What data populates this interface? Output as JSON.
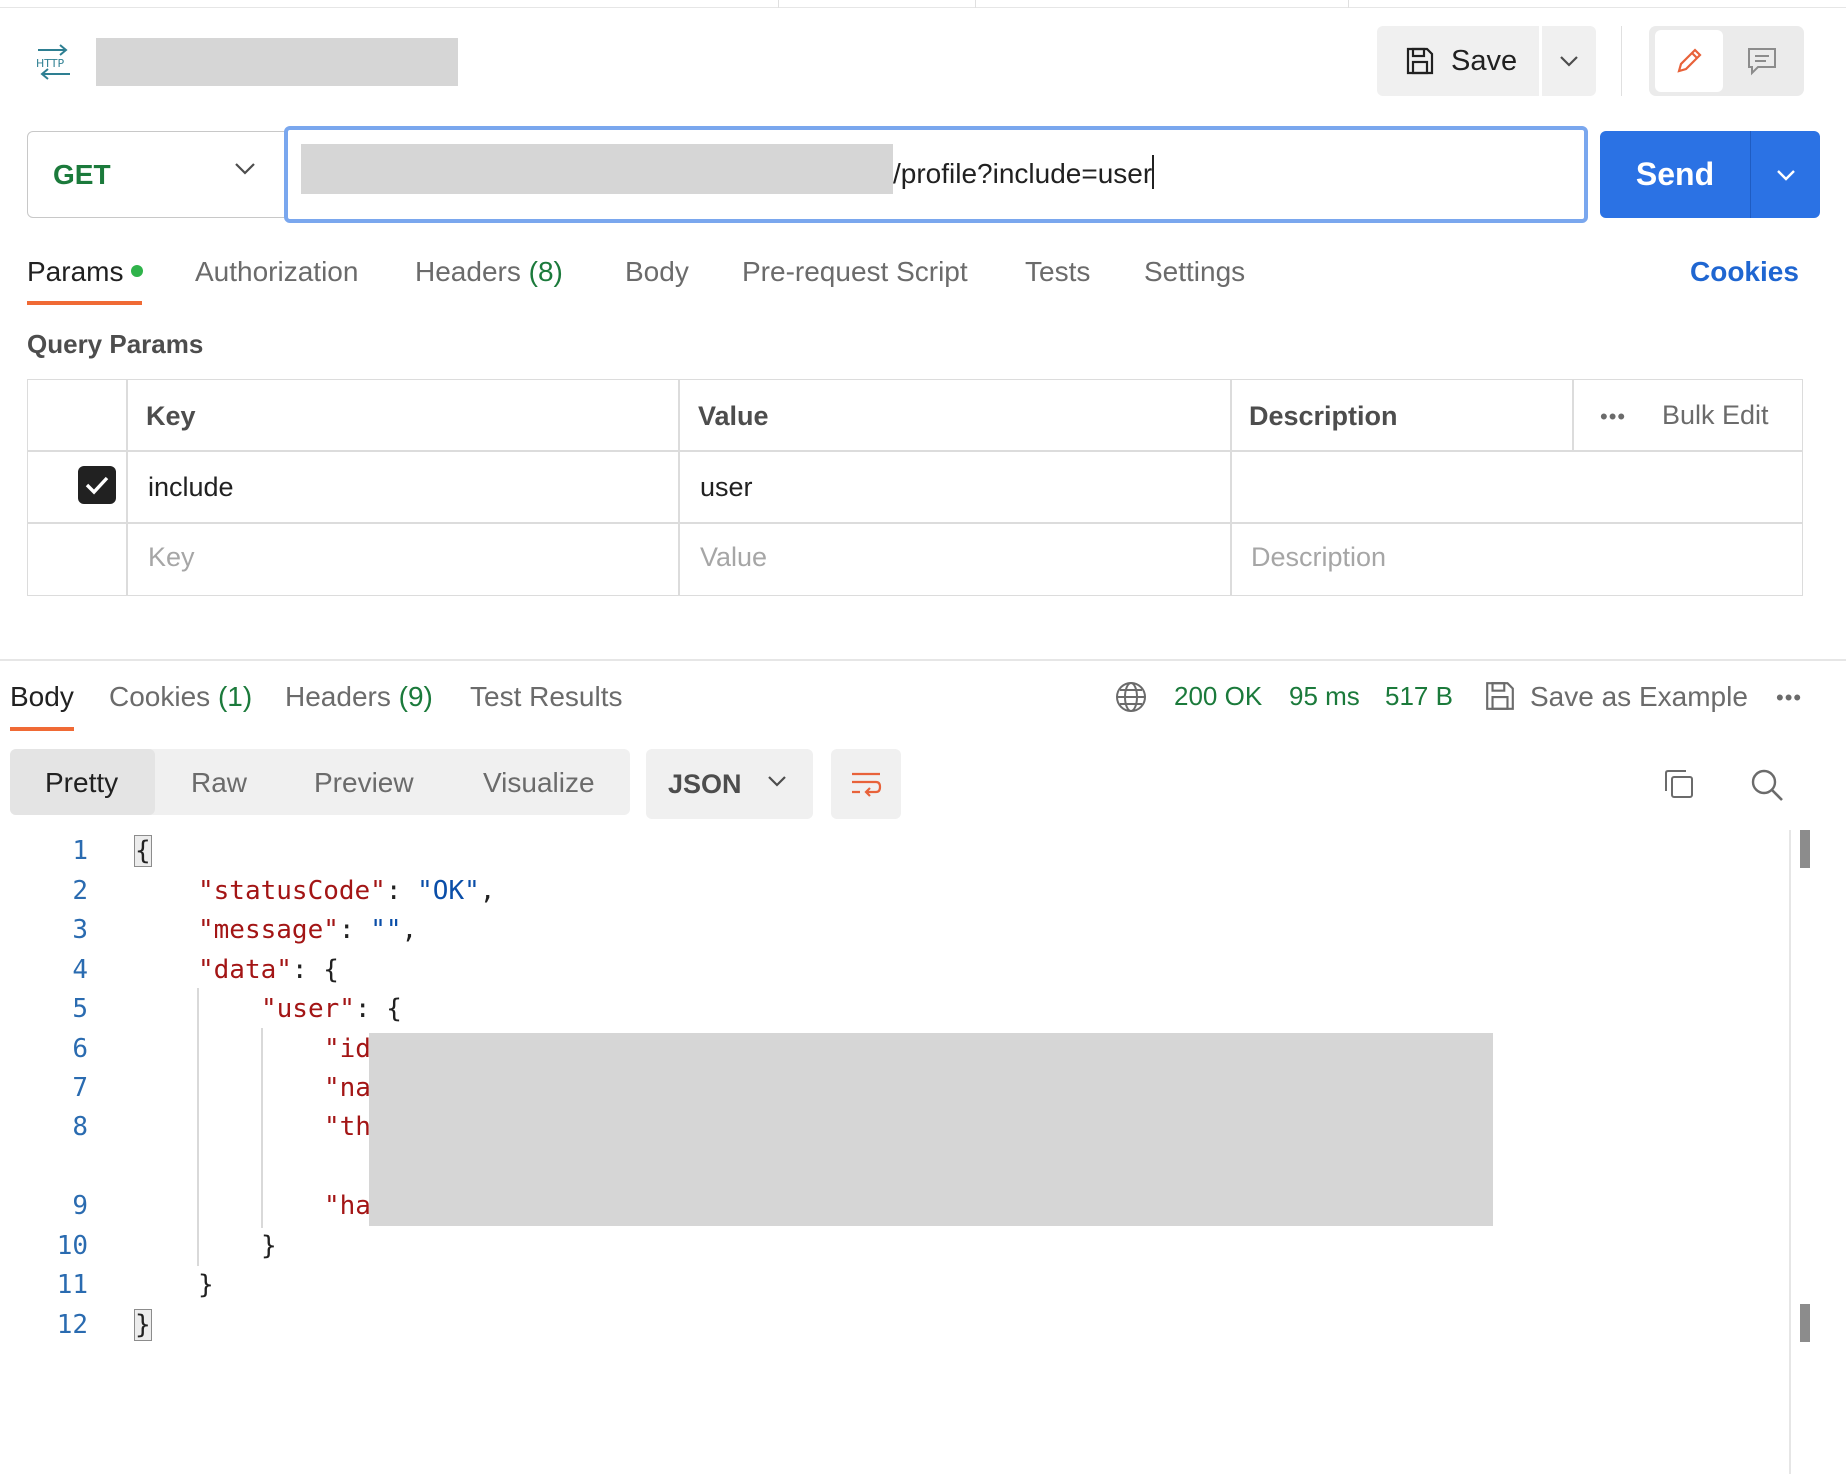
{
  "header": {
    "protocol_badge": "HTTP",
    "save_label": "Save"
  },
  "request": {
    "method": "GET",
    "url_visible": "/profile?include=user",
    "send_label": "Send"
  },
  "request_tabs": {
    "params": "Params",
    "authorization": "Authorization",
    "headers": "Headers",
    "headers_count": "(8)",
    "body": "Body",
    "prerequest": "Pre-request Script",
    "tests": "Tests",
    "settings": "Settings",
    "cookies": "Cookies"
  },
  "query_params": {
    "title": "Query Params",
    "columns": {
      "key": "Key",
      "value": "Value",
      "description": "Description"
    },
    "more": "•••",
    "bulk_edit": "Bulk Edit",
    "rows": [
      {
        "checked": true,
        "key": "include",
        "value": "user",
        "description": ""
      }
    ],
    "placeholder": {
      "key": "Key",
      "value": "Value",
      "description": "Description"
    }
  },
  "response_tabs": {
    "body": "Body",
    "cookies": "Cookies",
    "cookies_count": "(1)",
    "headers": "Headers",
    "headers_count": "(9)",
    "test_results": "Test Results"
  },
  "response_status": {
    "status": "200 OK",
    "time": "95 ms",
    "size": "517 B",
    "save_example": "Save as Example",
    "more": "•••",
    "status_color": "#1b7a3b"
  },
  "body_toolbar": {
    "views": [
      "Pretty",
      "Raw",
      "Preview",
      "Visualize"
    ],
    "active_view": "Pretty",
    "format": "JSON"
  },
  "code": {
    "line_numbers": [
      "1",
      "2",
      "3",
      "4",
      "5",
      "6",
      "7",
      "8",
      "9",
      "10",
      "11",
      "12"
    ],
    "l1": "{",
    "l2_key": "\"statusCode\"",
    "l2_sep": ": ",
    "l2_val": "\"OK\"",
    "l2_end": ",",
    "l3_key": "\"message\"",
    "l3_sep": ": ",
    "l3_val": "\"\"",
    "l3_end": ",",
    "l4_key": "\"data\"",
    "l4_rest": ": {",
    "l5_key": "\"user\"",
    "l5_rest": ": {",
    "l6_key": "\"id",
    "l7_key": "\"na",
    "l8_key": "\"th",
    "l9_key": "\"ha",
    "l10": "}",
    "l11": "}",
    "l12": "}"
  },
  "colors": {
    "accent": "#2b72e4",
    "tab_underline": "#f06a35",
    "method": "#1b7a3b",
    "json_key": "#a31515",
    "json_string": "#0a4ea8"
  }
}
